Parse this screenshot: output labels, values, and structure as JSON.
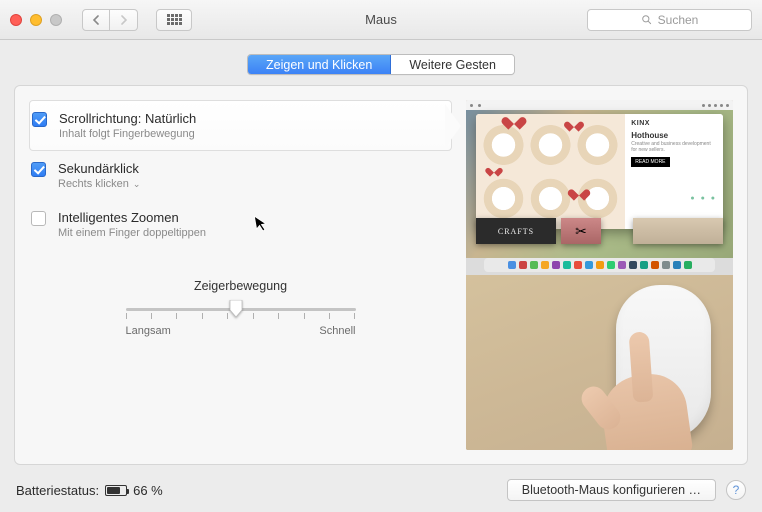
{
  "window": {
    "title": "Maus"
  },
  "search": {
    "placeholder": "Suchen"
  },
  "tabs": {
    "point_click": "Zeigen und Klicken",
    "more_gestures": "Weitere Gesten"
  },
  "options": {
    "scroll": {
      "title": "Scrollrichtung: Natürlich",
      "sub": "Inhalt folgt Fingerbewegung",
      "checked": true
    },
    "secondary": {
      "title": "Sekundärklick",
      "sub": "Rechts klicken",
      "checked": true
    },
    "zoom": {
      "title": "Intelligentes Zoomen",
      "sub": "Mit einem Finger doppeltippen",
      "checked": false
    }
  },
  "tracking": {
    "title": "Zeigerbewegung",
    "slow": "Langsam",
    "fast": "Schnell"
  },
  "preview": {
    "site_logo": "KINX",
    "headline": "Hothouse",
    "sub": "Creative and business development for new sellers.",
    "cta": "READ MORE",
    "crafts": "CRAFTS"
  },
  "battery": {
    "label": "Batteriestatus:",
    "value": "66 %"
  },
  "bluetooth_btn": "Bluetooth-Maus konfigurieren …",
  "help": "?",
  "colors": {
    "accent": "#3c82f6"
  }
}
